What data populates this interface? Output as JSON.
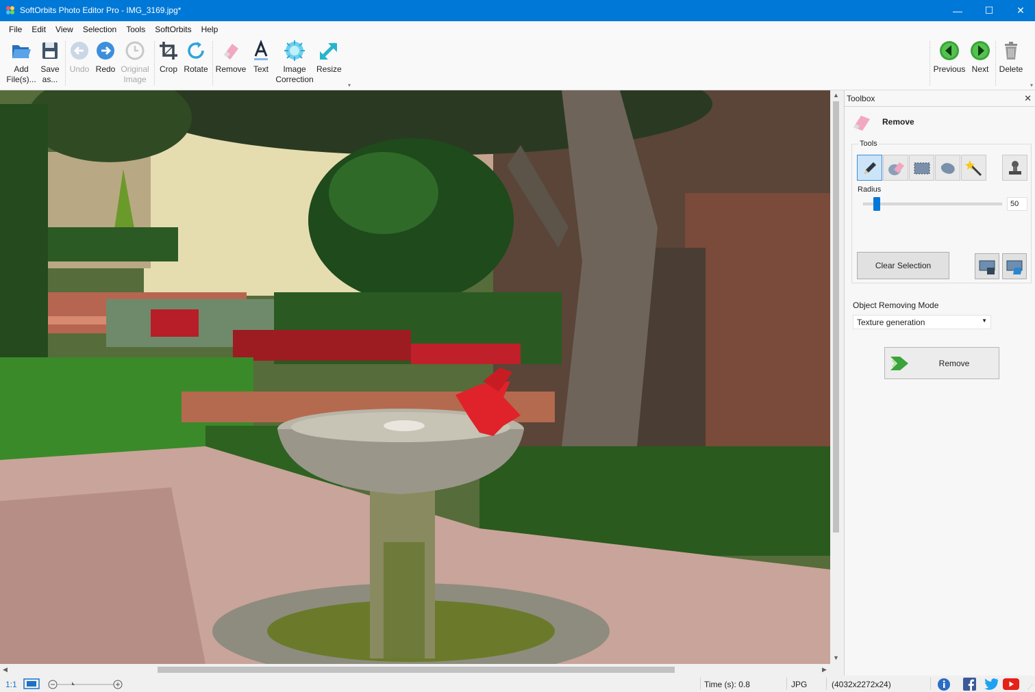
{
  "window": {
    "title": "SoftOrbits Photo Editor Pro - IMG_3169.jpg*",
    "minimize_glyph": "—",
    "maximize_glyph": "☐",
    "close_glyph": "✕"
  },
  "menu": [
    "File",
    "Edit",
    "View",
    "Selection",
    "Tools",
    "SoftOrbits",
    "Help"
  ],
  "toolbar": {
    "add_files": "Add File(s)...",
    "save_as": "Save as...",
    "undo": "Undo",
    "redo": "Redo",
    "original_image": "Original Image",
    "crop": "Crop",
    "rotate": "Rotate",
    "remove": "Remove",
    "text": "Text",
    "image_correction": "Image Correction",
    "resize": "Resize",
    "previous": "Previous",
    "next": "Next",
    "delete": "Delete"
  },
  "toolbox": {
    "title": "Toolbox",
    "close_glyph": "✕",
    "section_title": "Remove",
    "tools_label": "Tools",
    "tools": [
      "pencil-icon",
      "eraser-icon",
      "rect-select-icon",
      "lasso-icon",
      "magic-wand-icon",
      "stamp-icon"
    ],
    "radius_label": "Radius",
    "radius_value": "50",
    "radius_fraction": 0.1,
    "clear_selection": "Clear Selection",
    "mode_label": "Object Removing Mode",
    "mode_value": "Texture generation",
    "remove_button": "Remove"
  },
  "statusbar": {
    "zoom_ratio": "1:1",
    "time": "Time (s): 0.8",
    "format": "JPG",
    "dimensions": "(4032x2272x24)"
  },
  "colors": {
    "titlebar": "#0078d7",
    "accent_green": "#3aa43a",
    "selection_red": "#e0222a"
  }
}
